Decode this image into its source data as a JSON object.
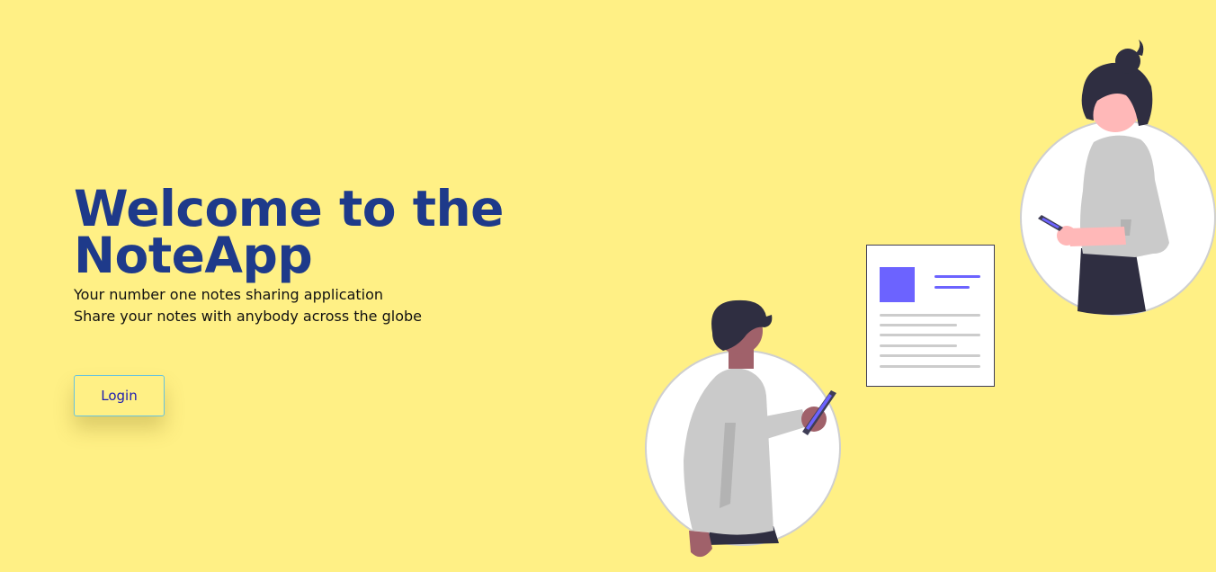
{
  "hero": {
    "title_line1": "Welcome to the",
    "title_line2": "NoteApp",
    "tagline_line1": "Your number one notes sharing application",
    "tagline_line2": "Share your notes with anybody across the globe"
  },
  "actions": {
    "login_label": "Login"
  },
  "colors": {
    "background": "#fff085",
    "title": "#1e3a8a",
    "accent": "#6c63ff",
    "button_border": "#67c3dd",
    "button_text": "#1d1db0"
  },
  "illustration": {
    "icon": "people-sharing-notes-illustration"
  }
}
